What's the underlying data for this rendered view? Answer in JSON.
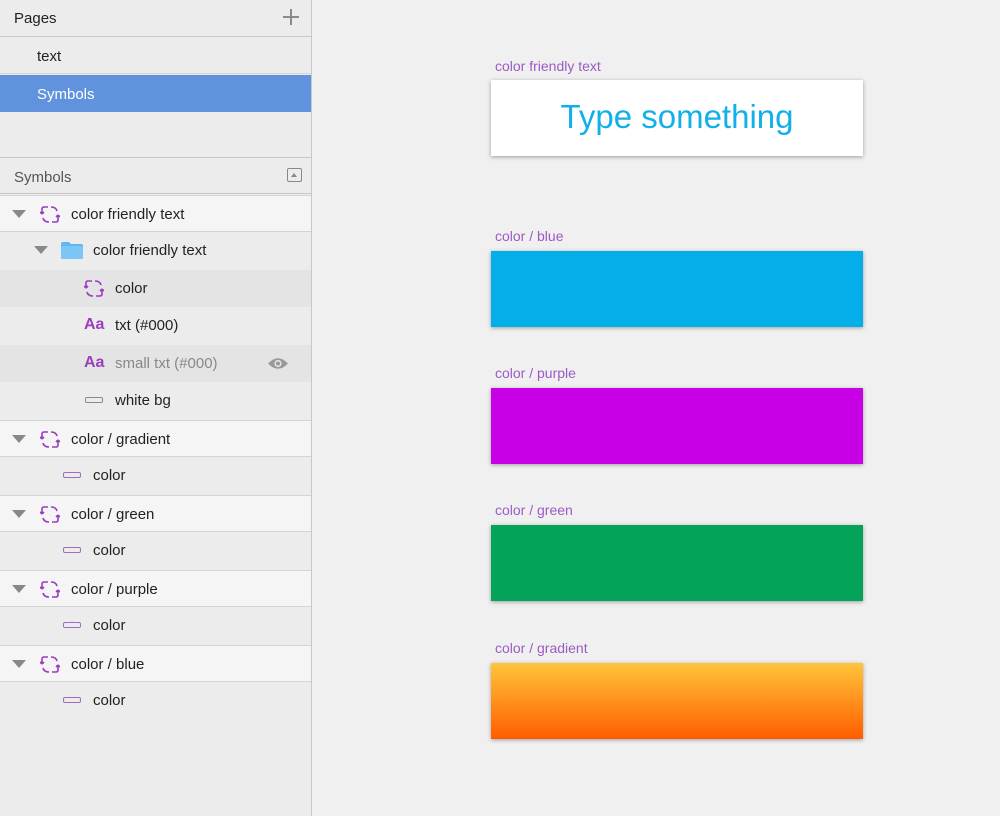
{
  "pages_panel": {
    "title": "Pages",
    "add_icon": "plus-icon",
    "pages": [
      {
        "label": "text",
        "selected": false
      },
      {
        "label": "Symbols",
        "selected": true
      }
    ]
  },
  "symbols_panel": {
    "title": "Symbols",
    "collapse_icon": "collapse-icon",
    "layers": [
      {
        "label": "color friendly text",
        "icon": "symbol-icon",
        "expanded": true
      },
      {
        "label": "color friendly text",
        "icon": "folder-icon",
        "expanded": true
      },
      {
        "label": "color",
        "icon": "symbol-icon"
      },
      {
        "label": "txt (#000)",
        "icon": "text-layer-icon",
        "icon_text": "Aa"
      },
      {
        "label": "small txt (#000)",
        "icon": "text-layer-icon",
        "icon_text": "Aa",
        "hidden": true,
        "visibility_icon": "eye-icon"
      },
      {
        "label": "white bg",
        "icon": "rectangle-icon"
      },
      {
        "label": "color / gradient",
        "icon": "symbol-icon",
        "expanded": true
      },
      {
        "label": "color",
        "icon": "rectangle-icon"
      },
      {
        "label": "color / green",
        "icon": "symbol-icon",
        "expanded": true
      },
      {
        "label": "color",
        "icon": "rectangle-icon"
      },
      {
        "label": "color / purple",
        "icon": "symbol-icon",
        "expanded": true
      },
      {
        "label": "color",
        "icon": "rectangle-icon"
      },
      {
        "label": "color / blue",
        "icon": "symbol-icon",
        "expanded": true
      },
      {
        "label": "color",
        "icon": "rectangle-icon"
      }
    ]
  },
  "canvas": {
    "artboards": [
      {
        "label": "color friendly text",
        "placeholder_text": "Type something",
        "fill": "#ffffff",
        "text_color": "#13b0e8"
      },
      {
        "label": "color / blue",
        "fill": "#03aee9"
      },
      {
        "label": "color / purple",
        "fill": "#c800e6"
      },
      {
        "label": "color / green",
        "fill": "#03a35a"
      },
      {
        "label": "color / gradient",
        "gradient_start": "#ffc53a",
        "gradient_end": "#ff5d00"
      }
    ]
  },
  "colors": {
    "selection": "#6092dd",
    "label_purple": "#9b5bc4",
    "icon_purple": "#9b3dbf"
  }
}
